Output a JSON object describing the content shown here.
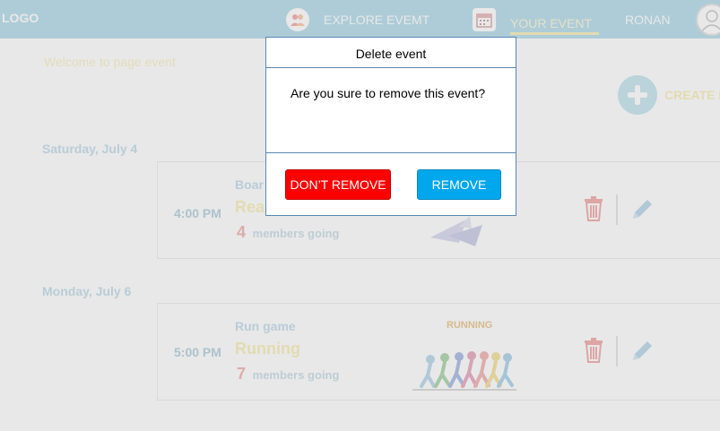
{
  "header": {
    "logo": "LOGO",
    "nav": [
      {
        "label": "EXPLORE EVEMT",
        "icon": "people-icon"
      },
      {
        "label": "YOUR EVENT",
        "icon": "calendar-icon",
        "active": true
      }
    ],
    "user_name": "RONAN",
    "avatar_icon": "user-avatar-icon"
  },
  "page": {
    "welcome": "Welcome to page event",
    "create_label": "CREATE E",
    "create_icon": "plus-icon"
  },
  "events": [
    {
      "date": "Saturday, July 4",
      "time": "4:00 PM",
      "category": "Boar",
      "title": "Rea",
      "going_count": "4",
      "going_text": "members going",
      "image": "paper-planes-image"
    },
    {
      "date": "Monday, July 6",
      "time": "5:00 PM",
      "category": "Run game",
      "title": "Running",
      "going_count": "7",
      "going_text": "members going",
      "image": "running-people-image",
      "image_text": "RUNNING"
    }
  ],
  "modal": {
    "title": "Delete event",
    "message": "Are you sure to remove this event?",
    "cancel_label": "DON’T REMOVE",
    "confirm_label": "REMOVE"
  },
  "colors": {
    "header_bg": "#b5dce9",
    "danger": "#ff0000",
    "primary": "#00a7ec",
    "modal_border": "#5a87b3"
  }
}
